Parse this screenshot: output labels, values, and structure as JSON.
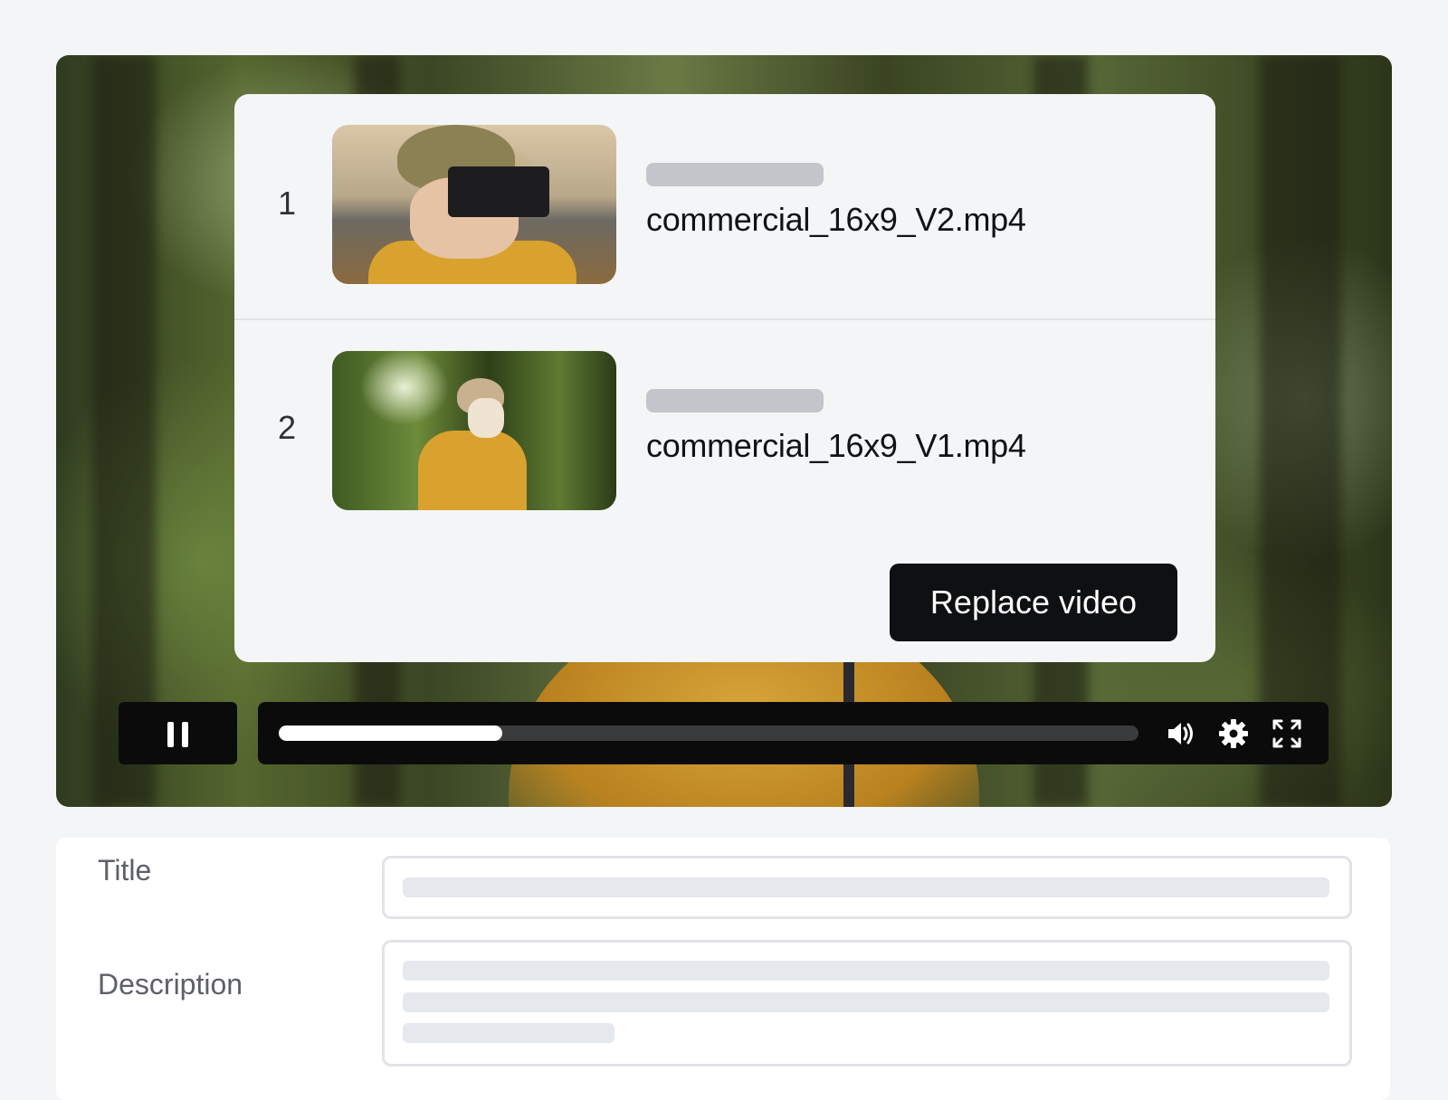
{
  "player": {
    "progress": 0.26,
    "controls": {
      "pause_icon": "pause-icon",
      "volume_icon": "volume-icon",
      "settings_icon": "gear-icon",
      "fullscreen_icon": "fullscreen-icon"
    }
  },
  "versions": [
    {
      "number": "1",
      "filename": "commercial_16x9_V2.mp4"
    },
    {
      "number": "2",
      "filename": "commercial_16x9_V1.mp4"
    }
  ],
  "replace_button": {
    "label": "Replace video"
  },
  "form": {
    "title_label": "Title",
    "description_label": "Description"
  },
  "colors": {
    "page_bg": "#f4f5f7",
    "button_bg": "#0f1012",
    "skeleton": "#c3c5ca",
    "field_border": "#e1e3e7"
  }
}
